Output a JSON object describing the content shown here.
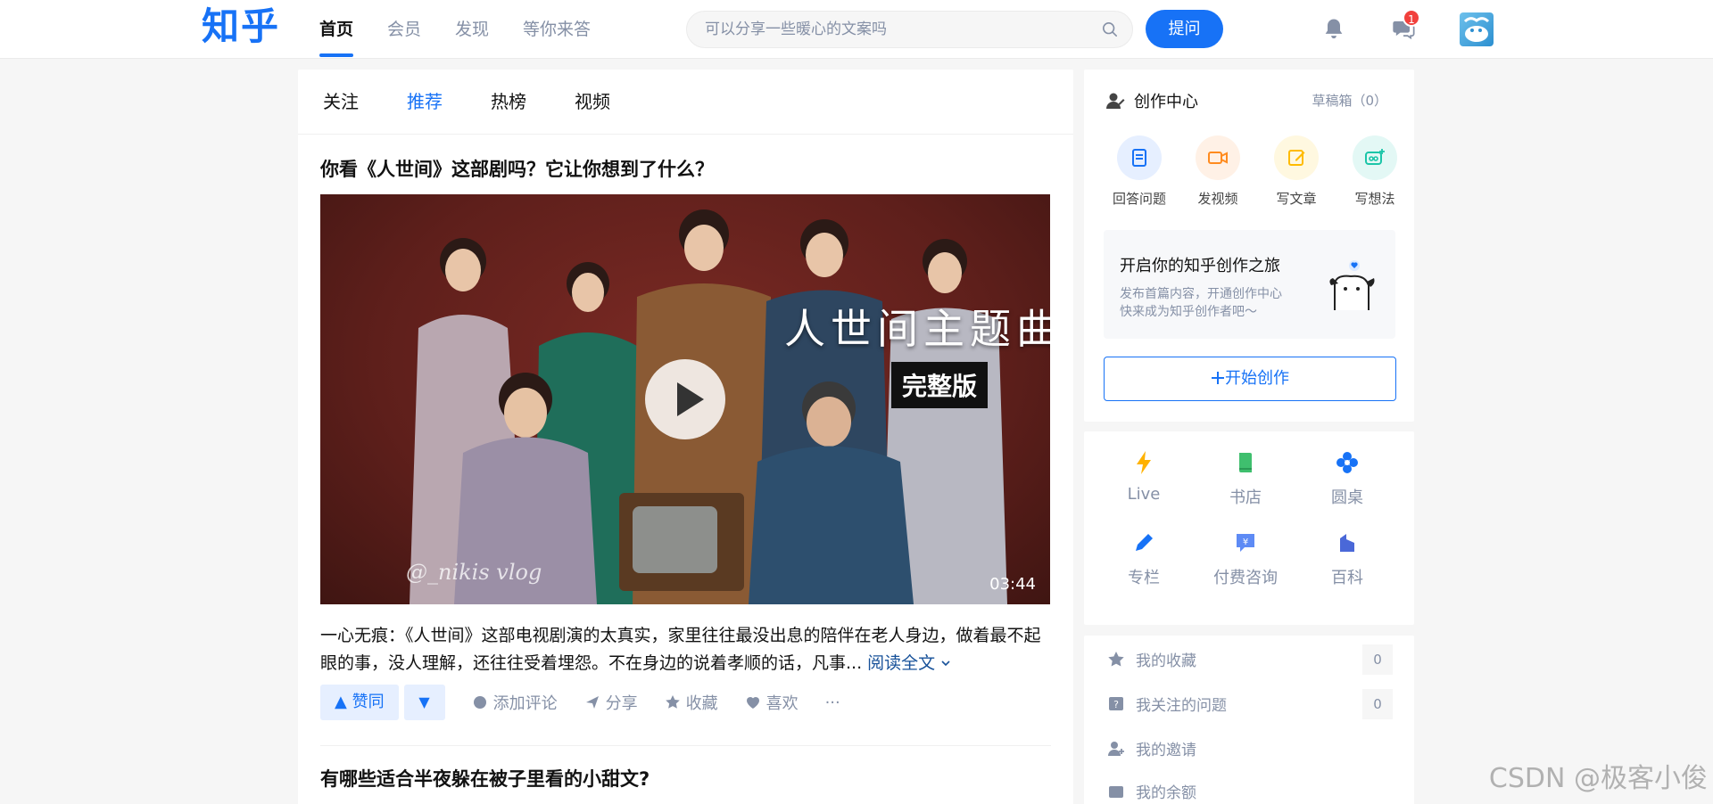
{
  "header": {
    "logo": "知乎",
    "nav": [
      "首页",
      "会员",
      "发现",
      "等你来答"
    ],
    "search_placeholder": "可以分享一些暖心的文案吗",
    "ask_label": "提问",
    "message_badge": "1"
  },
  "tabs": [
    "关注",
    "推荐",
    "热榜",
    "视频"
  ],
  "feed": {
    "item1": {
      "title": "你看《人世间》这部剧吗？它让你想到了什么？",
      "video_title": "人世间主题曲",
      "video_tag": "完整版",
      "video_watermark": "@_nikis vlog",
      "duration": "03:44",
      "excerpt": "一心无痕：《人世间》这部电视剧演的太真实，家里往往最没出息的陪伴在老人身边，做着最不起眼的事，没人理解，还往往受着埋怨。不在身边的说着孝顺的话，凡事...",
      "read_more": "阅读全文",
      "actions": {
        "upvote": "▲ 赞同",
        "downvote": "▼",
        "comment": "添加评论",
        "share": "分享",
        "favorite": "收藏",
        "like": "喜欢",
        "more": "···"
      }
    },
    "item2": {
      "title": "有哪些适合半夜躲在被子里看的小甜文?"
    }
  },
  "creation": {
    "title": "创作中心",
    "drafts": "草稿箱（0）",
    "actions": [
      "回答问题",
      "发视频",
      "写文章",
      "写想法"
    ],
    "journey_title": "开启你的知乎创作之旅",
    "journey_desc_line1": "发布首篇内容，开通创作中心",
    "journey_desc_line2": "快来成为知乎创作者吧～",
    "start_label": "开始创作"
  },
  "services": [
    "Live",
    "书店",
    "圆桌",
    "专栏",
    "付费咨询",
    "百科"
  ],
  "mylist": {
    "favorites": "我的收藏",
    "favorites_count": "0",
    "followed_questions": "我关注的问题",
    "followed_count": "0",
    "invitations": "我的邀请",
    "balance": "我的余额"
  },
  "watermark": "CSDN @极客小俊",
  "colors": {
    "brand": "#1772f6",
    "secondary_text": "#8590a6"
  }
}
